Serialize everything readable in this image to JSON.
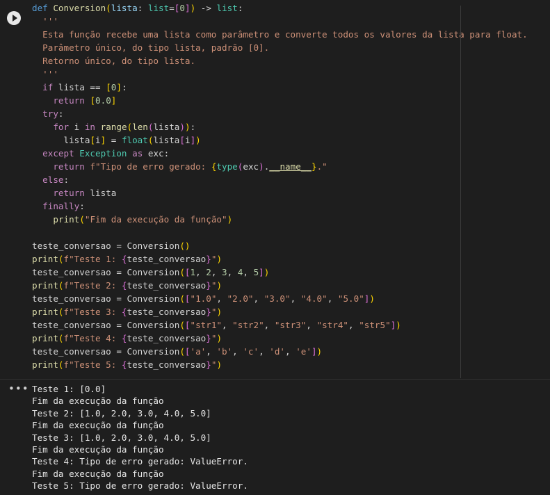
{
  "cell": {
    "run_button_label": "Run cell",
    "code_lines": [
      [
        [
          "kw",
          "def "
        ],
        [
          "fn",
          "Conversion"
        ],
        [
          "br1",
          "("
        ],
        [
          "var",
          "lista"
        ],
        [
          "plain",
          ": "
        ],
        [
          "bi",
          "list"
        ],
        [
          "plain",
          "="
        ],
        [
          "br2",
          "["
        ],
        [
          "num",
          "0"
        ],
        [
          "br2",
          "]"
        ],
        [
          "br1",
          ")"
        ],
        [
          "plain",
          " -> "
        ],
        [
          "bi",
          "list"
        ],
        [
          "plain",
          ":"
        ]
      ],
      [
        [
          "str",
          "  '''"
        ]
      ],
      [
        [
          "str",
          "  Esta função recebe uma lista como parâmetro e converte todos os valores da lista para float."
        ]
      ],
      [
        [
          "str",
          "  Parâmetro único, do tipo lista, padrão [0]."
        ]
      ],
      [
        [
          "str",
          "  Retorno único, do tipo lista."
        ]
      ],
      [
        [
          "str",
          "  '''"
        ]
      ],
      [
        [
          "plain",
          "  "
        ],
        [
          "ctl",
          "if"
        ],
        [
          "plain",
          " lista == "
        ],
        [
          "br1",
          "["
        ],
        [
          "num",
          "0"
        ],
        [
          "br1",
          "]"
        ],
        [
          "plain",
          ":"
        ]
      ],
      [
        [
          "plain",
          "    "
        ],
        [
          "ctl",
          "return"
        ],
        [
          "plain",
          " "
        ],
        [
          "br1",
          "["
        ],
        [
          "num",
          "0.0"
        ],
        [
          "br1",
          "]"
        ]
      ],
      [
        [
          "plain",
          "  "
        ],
        [
          "ctl",
          "try"
        ],
        [
          "plain",
          ":"
        ]
      ],
      [
        [
          "plain",
          "    "
        ],
        [
          "ctl",
          "for"
        ],
        [
          "plain",
          " i "
        ],
        [
          "ctl",
          "in"
        ],
        [
          "plain",
          " "
        ],
        [
          "fn",
          "range"
        ],
        [
          "br1",
          "("
        ],
        [
          "fn",
          "len"
        ],
        [
          "br2",
          "("
        ],
        [
          "plain",
          "lista"
        ],
        [
          "br2",
          ")"
        ],
        [
          "br1",
          ")"
        ],
        [
          "plain",
          ":"
        ]
      ],
      [
        [
          "plain",
          "      lista"
        ],
        [
          "br1",
          "["
        ],
        [
          "plain",
          "i"
        ],
        [
          "br1",
          "]"
        ],
        [
          "plain",
          " = "
        ],
        [
          "bi",
          "float"
        ],
        [
          "br1",
          "("
        ],
        [
          "plain",
          "lista"
        ],
        [
          "br2",
          "["
        ],
        [
          "plain",
          "i"
        ],
        [
          "br2",
          "]"
        ],
        [
          "br1",
          ")"
        ]
      ],
      [
        [
          "plain",
          "  "
        ],
        [
          "ctl",
          "except"
        ],
        [
          "plain",
          " "
        ],
        [
          "bi",
          "Exception"
        ],
        [
          "plain",
          " "
        ],
        [
          "ctl",
          "as"
        ],
        [
          "plain",
          " exc:"
        ]
      ],
      [
        [
          "plain",
          "    "
        ],
        [
          "ctl",
          "return"
        ],
        [
          "plain",
          " "
        ],
        [
          "str",
          "f\"Tipo de erro gerado: "
        ],
        [
          "br1",
          "{"
        ],
        [
          "bi",
          "type"
        ],
        [
          "br2",
          "("
        ],
        [
          "plain",
          "exc"
        ],
        [
          "br2",
          ")"
        ],
        [
          "plain",
          "."
        ],
        [
          "dund",
          "__name__"
        ],
        [
          "br1",
          "}"
        ],
        [
          "str",
          ".\""
        ]
      ],
      [
        [
          "plain",
          "  "
        ],
        [
          "ctl",
          "else"
        ],
        [
          "plain",
          ":"
        ]
      ],
      [
        [
          "plain",
          "    "
        ],
        [
          "ctl",
          "return"
        ],
        [
          "plain",
          " lista"
        ]
      ],
      [
        [
          "plain",
          "  "
        ],
        [
          "ctl",
          "finally"
        ],
        [
          "plain",
          ":"
        ]
      ],
      [
        [
          "plain",
          "    "
        ],
        [
          "fn",
          "print"
        ],
        [
          "br1",
          "("
        ],
        [
          "str",
          "\"Fim da execução da função\""
        ],
        [
          "br1",
          ")"
        ]
      ],
      [
        [
          "plain",
          " "
        ]
      ],
      [
        [
          "plain",
          "teste_conversao = Conversion"
        ],
        [
          "br1",
          "("
        ],
        [
          "br1",
          ")"
        ]
      ],
      [
        [
          "fn",
          "print"
        ],
        [
          "br1",
          "("
        ],
        [
          "str",
          "f\"Teste 1: "
        ],
        [
          "br2",
          "{"
        ],
        [
          "plain",
          "teste_conversao"
        ],
        [
          "br2",
          "}"
        ],
        [
          "str",
          "\""
        ],
        [
          "br1",
          ")"
        ]
      ],
      [
        [
          "plain",
          "teste_conversao = Conversion"
        ],
        [
          "br1",
          "("
        ],
        [
          "br2",
          "["
        ],
        [
          "num",
          "1"
        ],
        [
          "plain",
          ", "
        ],
        [
          "num",
          "2"
        ],
        [
          "plain",
          ", "
        ],
        [
          "num",
          "3"
        ],
        [
          "plain",
          ", "
        ],
        [
          "num",
          "4"
        ],
        [
          "plain",
          ", "
        ],
        [
          "num",
          "5"
        ],
        [
          "br2",
          "]"
        ],
        [
          "br1",
          ")"
        ]
      ],
      [
        [
          "fn",
          "print"
        ],
        [
          "br1",
          "("
        ],
        [
          "str",
          "f\"Teste 2: "
        ],
        [
          "br2",
          "{"
        ],
        [
          "plain",
          "teste_conversao"
        ],
        [
          "br2",
          "}"
        ],
        [
          "str",
          "\""
        ],
        [
          "br1",
          ")"
        ]
      ],
      [
        [
          "plain",
          "teste_conversao = Conversion"
        ],
        [
          "br1",
          "("
        ],
        [
          "br2",
          "["
        ],
        [
          "str",
          "\"1.0\""
        ],
        [
          "plain",
          ", "
        ],
        [
          "str",
          "\"2.0\""
        ],
        [
          "plain",
          ", "
        ],
        [
          "str",
          "\"3.0\""
        ],
        [
          "plain",
          ", "
        ],
        [
          "str",
          "\"4.0\""
        ],
        [
          "plain",
          ", "
        ],
        [
          "str",
          "\"5.0\""
        ],
        [
          "br2",
          "]"
        ],
        [
          "br1",
          ")"
        ]
      ],
      [
        [
          "fn",
          "print"
        ],
        [
          "br1",
          "("
        ],
        [
          "str",
          "f\"Teste 3: "
        ],
        [
          "br2",
          "{"
        ],
        [
          "plain",
          "teste_conversao"
        ],
        [
          "br2",
          "}"
        ],
        [
          "str",
          "\""
        ],
        [
          "br1",
          ")"
        ]
      ],
      [
        [
          "plain",
          "teste_conversao = Conversion"
        ],
        [
          "br1",
          "("
        ],
        [
          "br2",
          "["
        ],
        [
          "str",
          "\"str1\""
        ],
        [
          "plain",
          ", "
        ],
        [
          "str",
          "\"str2\""
        ],
        [
          "plain",
          ", "
        ],
        [
          "str",
          "\"str3\""
        ],
        [
          "plain",
          ", "
        ],
        [
          "str",
          "\"str4\""
        ],
        [
          "plain",
          ", "
        ],
        [
          "str",
          "\"str5\""
        ],
        [
          "br2",
          "]"
        ],
        [
          "br1",
          ")"
        ]
      ],
      [
        [
          "fn",
          "print"
        ],
        [
          "br1",
          "("
        ],
        [
          "str",
          "f\"Teste 4: "
        ],
        [
          "br2",
          "{"
        ],
        [
          "plain",
          "teste_conversao"
        ],
        [
          "br2",
          "}"
        ],
        [
          "str",
          "\""
        ],
        [
          "br1",
          ")"
        ]
      ],
      [
        [
          "plain",
          "teste_conversao = Conversion"
        ],
        [
          "br1",
          "("
        ],
        [
          "br2",
          "["
        ],
        [
          "str",
          "'a'"
        ],
        [
          "plain",
          ", "
        ],
        [
          "str",
          "'b'"
        ],
        [
          "plain",
          ", "
        ],
        [
          "str",
          "'c'"
        ],
        [
          "plain",
          ", "
        ],
        [
          "str",
          "'d'"
        ],
        [
          "plain",
          ", "
        ],
        [
          "str",
          "'e'"
        ],
        [
          "br2",
          "]"
        ],
        [
          "br1",
          ")"
        ]
      ],
      [
        [
          "fn",
          "print"
        ],
        [
          "br1",
          "("
        ],
        [
          "str",
          "f\"Teste 5: "
        ],
        [
          "br2",
          "{"
        ],
        [
          "plain",
          "teste_conversao"
        ],
        [
          "br2",
          "}"
        ],
        [
          "str",
          "\""
        ],
        [
          "br1",
          ")"
        ]
      ]
    ]
  },
  "output": {
    "menu_label": "•••",
    "lines": [
      "Teste 1: [0.0]",
      "Fim da execução da função",
      "Teste 2: [1.0, 2.0, 3.0, 4.0, 5.0]",
      "Fim da execução da função",
      "Teste 3: [1.0, 2.0, 3.0, 4.0, 5.0]",
      "Fim da execução da função",
      "Teste 4: Tipo de erro gerado: ValueError.",
      "Fim da execução da função",
      "Teste 5: Tipo de erro gerado: ValueError."
    ]
  },
  "colors": {
    "background": "#1e1e1e",
    "keyword": "#569cd6",
    "control": "#c586c0",
    "function": "#dcdcaa",
    "string": "#ce9178",
    "number": "#b5cea8",
    "builtin": "#4ec9b0"
  }
}
